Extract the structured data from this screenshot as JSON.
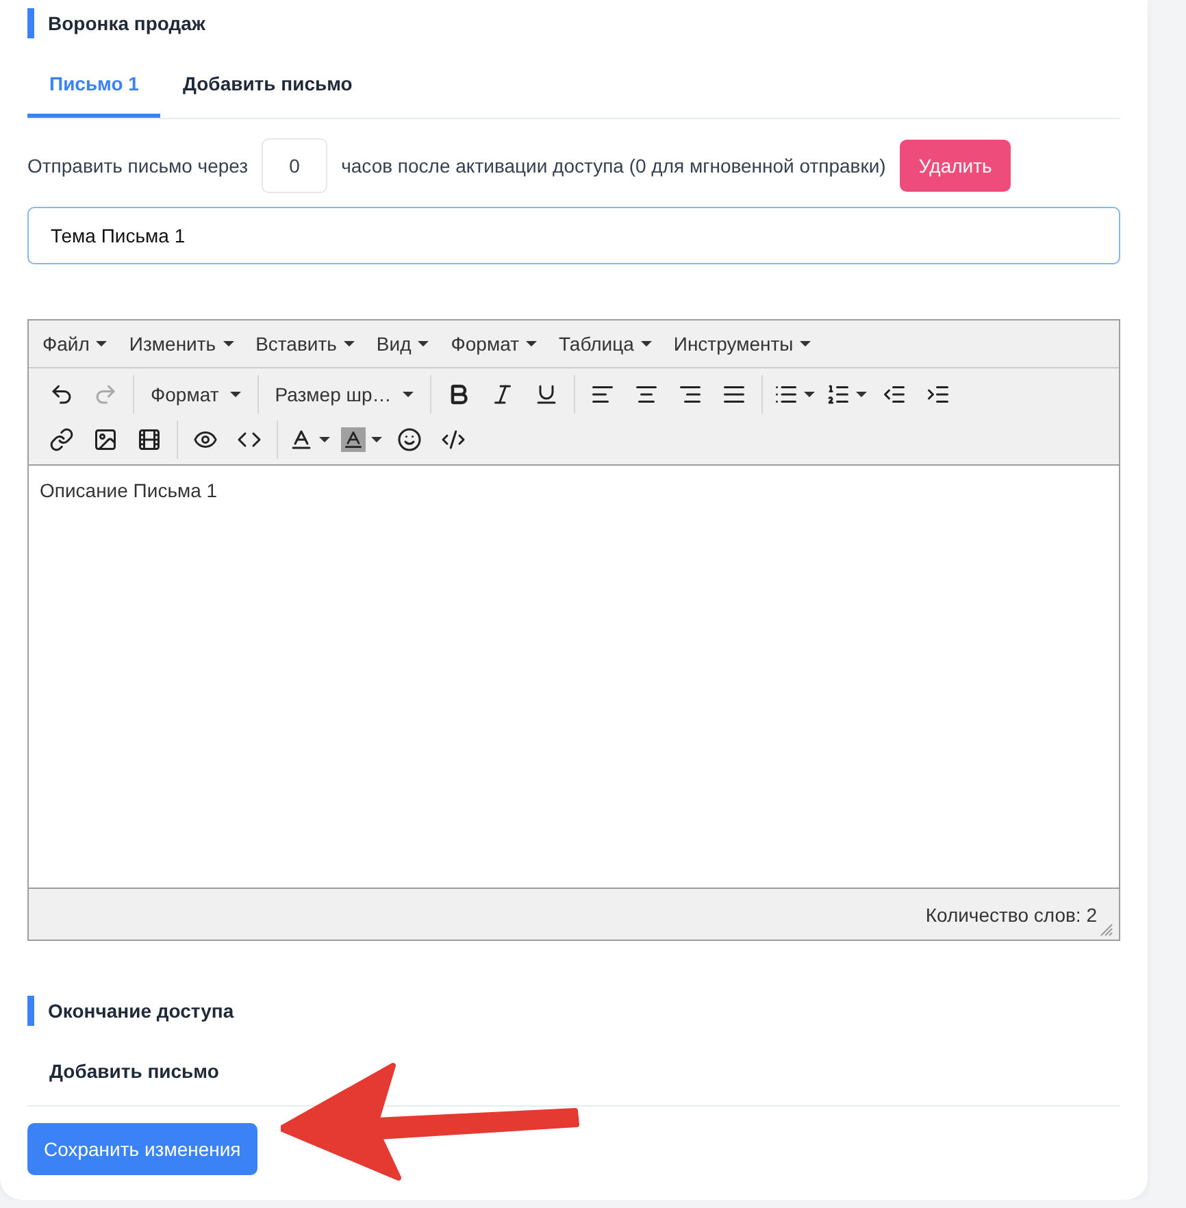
{
  "sections": [
    {
      "title": "Воронка продаж",
      "tabs": [
        {
          "label": "Письмо 1",
          "selected": true
        },
        {
          "label": "Добавить письмо",
          "selected": false
        }
      ],
      "delay": {
        "prefix": "Отправить письмо через",
        "value": "0",
        "suffix": "часов после активации доступа (0 для мгновенной отправки)"
      },
      "delete_button": "Удалить",
      "subject": {
        "value": "Тема Письма 1"
      },
      "editor": {
        "menu": [
          "Файл",
          "Изменить",
          "Вставить",
          "Вид",
          "Формат",
          "Таблица",
          "Инструменты"
        ],
        "format_dropdown": "Формат",
        "size_dropdown": "Размер шр…",
        "content": "Описание Письма 1",
        "word_count": "Количество слов: 2"
      }
    },
    {
      "title": "Окончание доступа",
      "tabs": [
        {
          "label": "Добавить письмо",
          "selected": false
        }
      ]
    }
  ],
  "save_button": "Сохранить изменения",
  "annotation": {
    "kind": "arrow"
  }
}
